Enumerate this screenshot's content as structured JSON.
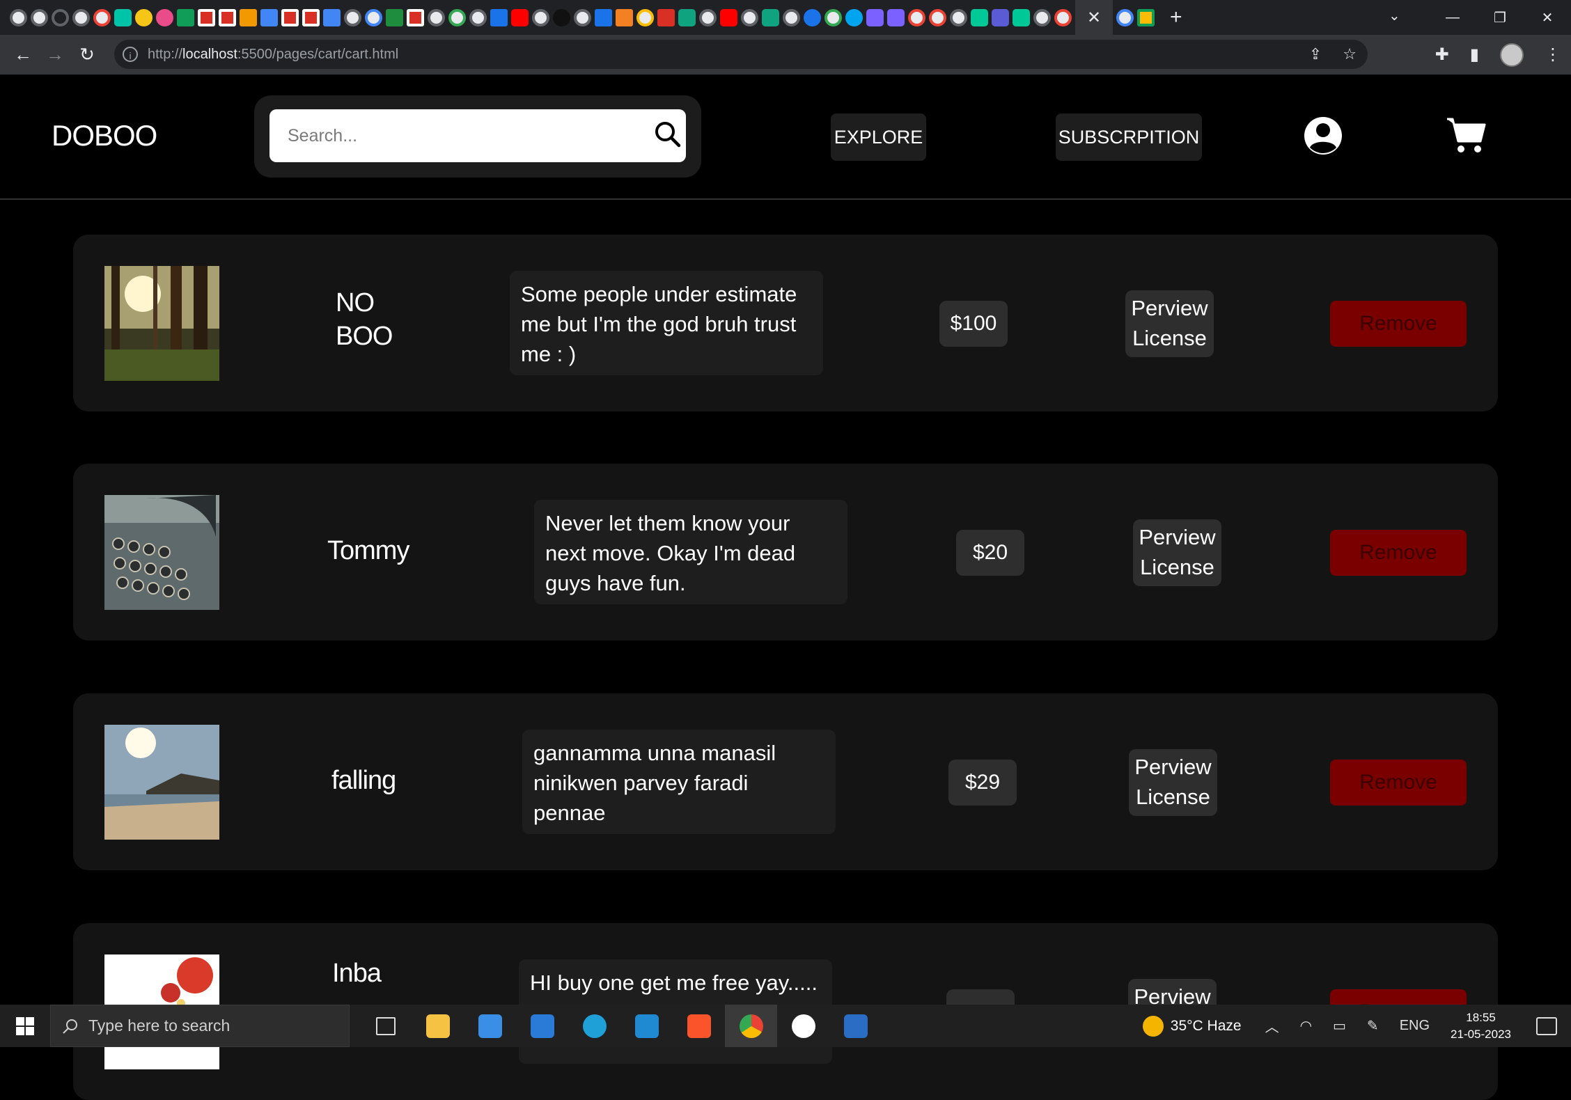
{
  "browser": {
    "url_prefix": "http://",
    "url_host": "localhost",
    "url_rest": ":5500/pages/cart/cart.html",
    "close_tab": "✕",
    "new_tab": "+"
  },
  "site": {
    "logo": "DOBOO",
    "search_placeholder": "Search...",
    "nav_explore": "EXPLORE",
    "nav_subscription": "SUBSCRPITION"
  },
  "cart": {
    "remove_label": "Remove",
    "license_line1": "Perview",
    "license_line2": "License",
    "items": [
      {
        "name_line1": "NO",
        "name_line2": "BOO",
        "description": "Some people under estimate me but I'm the god bruh trust me : )",
        "price": "$100",
        "thumb": "forest"
      },
      {
        "name_line1": "Tommy",
        "name_line2": "",
        "description": "Never let them know your next move. Okay I'm dead guys have fun.",
        "price": "$20",
        "thumb": "typewriter"
      },
      {
        "name_line1": "falling",
        "name_line2": "",
        "description": "gannamma unna manasil ninikwen parvey faradi pennae",
        "price": "$29",
        "thumb": "beach"
      },
      {
        "name_line1": "Inba",
        "name_line2": "",
        "description": "HI buy one get me free yay.....",
        "price": "",
        "thumb": "food"
      }
    ]
  },
  "taskbar": {
    "search_text": "Type here to search",
    "weather": "35°C  Haze",
    "lang": "ENG",
    "time": "18:55",
    "date": "21-05-2023"
  }
}
